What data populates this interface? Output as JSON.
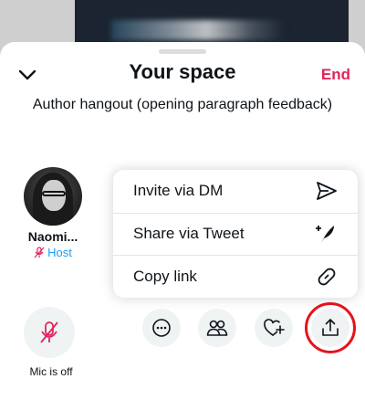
{
  "header": {
    "title": "Your space",
    "end_label": "End",
    "subtitle": "Author hangout (opening paragraph feedback)"
  },
  "participant": {
    "name": "Naomi...",
    "role": "Host"
  },
  "share_menu": {
    "items": [
      {
        "label": "Invite via DM",
        "icon": "send-icon"
      },
      {
        "label": "Share via Tweet",
        "icon": "compose-tweet-icon"
      },
      {
        "label": "Copy link",
        "icon": "link-icon"
      }
    ]
  },
  "controls": {
    "mic_label": "Mic is off",
    "buttons": [
      "more-icon",
      "people-icon",
      "heart-plus-icon",
      "share-icon"
    ]
  },
  "colors": {
    "accent_blue": "#1d9bf0",
    "end_red": "#e0245e",
    "mic_off_red": "#e0245e",
    "highlight_ring": "#e5141a"
  }
}
